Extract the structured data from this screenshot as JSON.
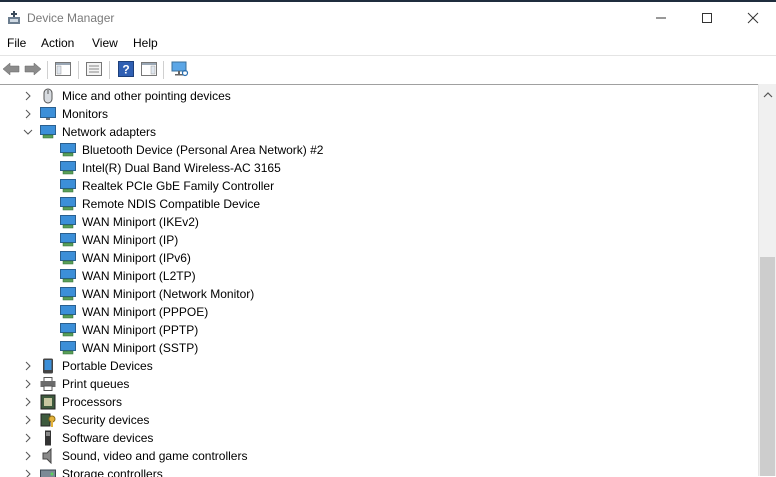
{
  "window": {
    "title": "Device Manager",
    "controls": {
      "minimize_icon": "minimize-icon",
      "maximize_icon": "maximize-icon",
      "close_icon": "close-icon"
    }
  },
  "menubar": {
    "items": [
      "File",
      "Action",
      "View",
      "Help"
    ]
  },
  "toolbar": {
    "buttons": [
      "back-arrow-icon",
      "forward-arrow-icon",
      "show-hide-console-tree-icon",
      "properties-icon",
      "help-icon",
      "action-pane-icon",
      "scan-hardware-changes-icon"
    ]
  },
  "tree": {
    "categories": [
      {
        "label": "Mice and other pointing devices",
        "icon": "mouse-icon",
        "expanded": false
      },
      {
        "label": "Monitors",
        "icon": "monitor-icon",
        "expanded": false
      },
      {
        "label": "Network adapters",
        "icon": "network-adapter-icon",
        "expanded": true,
        "children": [
          "Bluetooth Device (Personal Area Network) #2",
          "Intel(R) Dual Band Wireless-AC 3165",
          "Realtek PCIe GbE Family Controller",
          "Remote NDIS Compatible Device",
          "WAN Miniport (IKEv2)",
          "WAN Miniport (IP)",
          "WAN Miniport (IPv6)",
          "WAN Miniport (L2TP)",
          "WAN Miniport (Network Monitor)",
          "WAN Miniport (PPPOE)",
          "WAN Miniport (PPTP)",
          "WAN Miniport (SSTP)"
        ]
      },
      {
        "label": "Portable Devices",
        "icon": "portable-device-icon",
        "expanded": false
      },
      {
        "label": "Print queues",
        "icon": "printer-icon",
        "expanded": false
      },
      {
        "label": "Processors",
        "icon": "processor-icon",
        "expanded": false
      },
      {
        "label": "Security devices",
        "icon": "security-device-icon",
        "expanded": false
      },
      {
        "label": "Software devices",
        "icon": "software-device-icon",
        "expanded": false
      },
      {
        "label": "Sound, video and game controllers",
        "icon": "speaker-icon",
        "expanded": false
      },
      {
        "label": "Storage controllers",
        "icon": "storage-controller-icon",
        "expanded": false
      }
    ]
  },
  "colors": {
    "title_text": "#7a7a7a",
    "network_icon": "#3c8fd8",
    "accent": "#1f2d3d"
  }
}
